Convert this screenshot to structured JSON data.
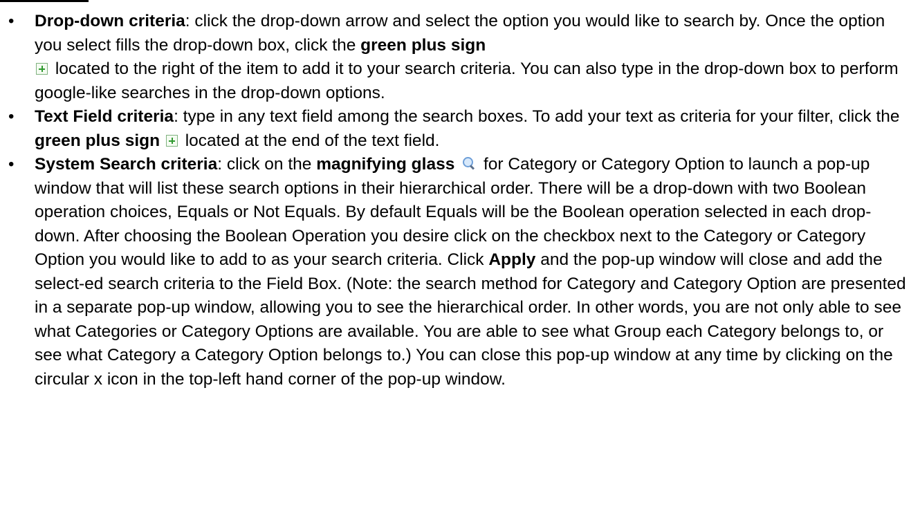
{
  "bullet_glyph": "•",
  "bullets": [
    {
      "lead": "Drop-down criteria",
      "text_1": ": click the drop-down arrow and select the option you would like to search by. Once the option you select fills the drop-down box, click the ",
      "bold_1": "green plus sign",
      "text_2": "located to the right of the item to add it to your search criteria. You can also type in the drop-down box to perform google-like searches in the drop-down options.",
      "icon": "green-plus-icon"
    },
    {
      "lead": "Text Field criteria",
      "text_1": ": type in any text field among the search boxes. To add your text as criteria for your filter, click the ",
      "bold_1": "green plus sign",
      "text_2": "located at the end of the text field.",
      "icon": "green-plus-icon"
    },
    {
      "lead": "System Search criteria",
      "text_1": ": click on the ",
      "bold_1": "magnifying glass",
      "text_2": "for Category or Category Option to launch a pop-up window that will list these search options in their hierarchical order. There will be a drop-down with two Boolean operation choices, Equals or Not Equals. By default Equals will be the Boolean operation selected in each drop-down. After choosing the Boolean Operation you desire click on the checkbox next to the Category or Category Option you would like to add to as your search criteria. Click ",
      "bold_2": "Apply",
      "text_3": " and the pop-up window will close and add the select-ed search criteria to the Field Box. (Note: the search method for Category and Category Option are presented in a separate pop-up window, allowing you to see the hierarchical order. In other words, you are not only able to see what Categories or Category Options are available. You are able to see what Group each Category belongs to, or see what Category a Category Option belongs to.) You can close this pop-up window at any time by clicking on the circular x icon in the top-left hand corner of the pop-up window.",
      "icon": "magnifying-glass-icon"
    }
  ],
  "colors": {
    "plus_icon_green": "#2f9a2f",
    "magnifier_blue": "#6e9fd8"
  }
}
